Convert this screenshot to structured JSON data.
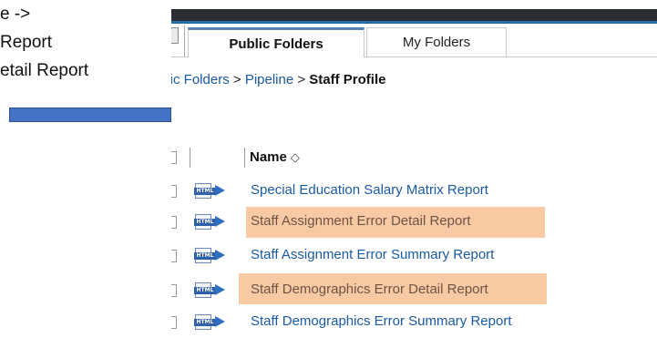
{
  "document_text": {
    "lines": [
      "e ->",
      "Report",
      "etail Report"
    ]
  },
  "tabs": {
    "public_folders": "Public Folders",
    "my_folders": "My Folders"
  },
  "breadcrumb": {
    "items": [
      "blic Folders",
      "Pipeline"
    ],
    "separator": ">",
    "current": "Staff Profile"
  },
  "list": {
    "header_name": "Name",
    "sort_glyph": "◇",
    "icon_label": "HTML",
    "rows": [
      {
        "label": "Special Education Salary Matrix Report",
        "highlighted": false
      },
      {
        "label": "Staff Assignment Error Detail Report",
        "highlighted": true
      },
      {
        "label": "Staff Assignment Error Summary Report",
        "highlighted": false
      },
      {
        "label": "Staff Demographics Error Detail Report",
        "highlighted": true
      },
      {
        "label": "Staff Demographics Error Summary Report",
        "highlighted": false
      }
    ]
  },
  "colors": {
    "highlight": "#f8caa4",
    "link": "#1a5aa0",
    "topbar": "#2a2d34",
    "annotation_bar": "#4472c4"
  }
}
